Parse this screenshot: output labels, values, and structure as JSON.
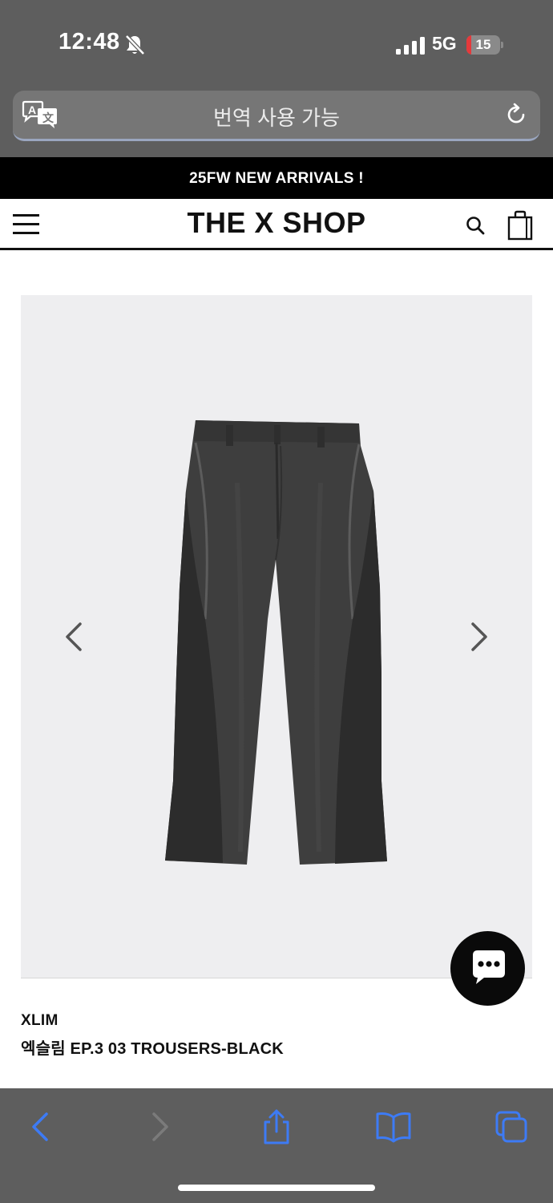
{
  "status_bar": {
    "time": "12:48",
    "network": "5G",
    "battery": "15",
    "battery_level": 0.15,
    "icons": [
      "bell-slash-icon",
      "cellular-signal-icon",
      "battery-icon"
    ]
  },
  "browser": {
    "address_text": "번역 사용 가능",
    "icons": [
      "translate-icon",
      "reload-icon"
    ],
    "toolbar_icons": [
      "back-icon",
      "forward-icon",
      "share-icon",
      "bookmarks-icon",
      "tabs-icon"
    ],
    "accent_color": "#3d7bf5"
  },
  "site": {
    "promo": "25FW NEW ARRIVALS !",
    "logo": "THE X SHOP",
    "header_icons": [
      "hamburger-menu-icon",
      "search-icon",
      "shopping-bag-icon"
    ]
  },
  "product": {
    "brand": "XLIM",
    "name": "엑슬림 EP.3 03 TROUSERS-BLACK",
    "image": "black-corduroy-trousers",
    "gallery_icons": [
      "chevron-left-icon",
      "chevron-right-icon"
    ],
    "chat_icon": "chat-bubble-icon"
  }
}
